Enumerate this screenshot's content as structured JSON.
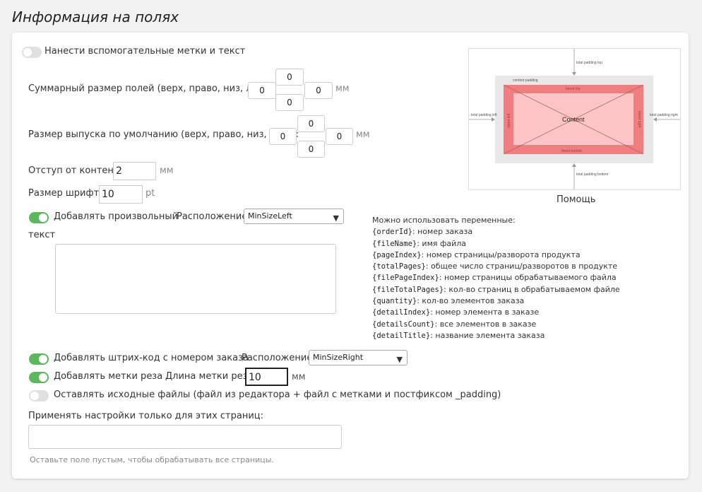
{
  "page": {
    "title": "Информация на полях"
  },
  "marks_toggle": {
    "label": "Нанести вспомогательные метки и текст",
    "on": false
  },
  "total_margins": {
    "label": "Суммарный размер полей (верх, право, низ, лево):",
    "top": "0",
    "right": "0",
    "bottom": "0",
    "left": "0",
    "unit": "мм"
  },
  "bleed": {
    "label": "Размер выпуска по умолчанию (верх, право, низ, лево):",
    "top": "0",
    "right": "0",
    "bottom": "0",
    "left": "0",
    "unit": "мм"
  },
  "content_offset": {
    "label": "Отступ от контента:",
    "value": "2",
    "unit": "мм"
  },
  "font_size": {
    "label": "Размер шрифта:",
    "value": "10",
    "unit": "pt"
  },
  "custom_text": {
    "toggle_label": "Добавлять произвольный",
    "toggle_label_2": "текст",
    "on": true,
    "position_label": "Расположение:",
    "position_value": "MinSizeLeft",
    "text": ""
  },
  "help": {
    "caption": "Помощь",
    "diagram": {
      "total_padding_top": "total padding top",
      "total_padding_left": "total padding left",
      "total_padding_right": "total padding right",
      "total_padding_bottom": "total padding bottom",
      "content_padding": "content padding",
      "bleed_top": "bleed top",
      "bleed_left": "bleed left",
      "bleed_right": "bleed right",
      "bleed_bottom": "bleed bottom",
      "content": "Content"
    }
  },
  "variables": {
    "intro": "Можно использовать переменные:",
    "items": [
      {
        "name": "{orderId}",
        "desc": ": номер заказа"
      },
      {
        "name": "{fileName}",
        "desc": ": имя файла"
      },
      {
        "name": "{pageIndex}",
        "desc": ": номер страницы/разворота продукта"
      },
      {
        "name": "{totalPages}",
        "desc": ": общее число страниц/разворотов в продукте"
      },
      {
        "name": "{filePageIndex}",
        "desc": ": номер страницы обрабатываемого файла"
      },
      {
        "name": "{fileTotalPages}",
        "desc": ": кол-во страниц в обрабатываемом файле"
      },
      {
        "name": "{quantity}",
        "desc": ": кол-во элементов заказа"
      },
      {
        "name": "{detailIndex}",
        "desc": ": номер элемента в заказе"
      },
      {
        "name": "{detailsCount}",
        "desc": ": все элементов в заказе"
      },
      {
        "name": "{detailTitle}",
        "desc": ": название элемента заказа"
      }
    ]
  },
  "barcode": {
    "label": "Добавлять штрих-код с номером заказа",
    "on": true,
    "position_label": "Расположение:",
    "position_value": "MinSizeRight"
  },
  "crop_marks": {
    "label": "Добавлять метки реза",
    "on": true,
    "length_label": "Длина метки реза:",
    "length_value": "10",
    "unit": "мм"
  },
  "keep_files": {
    "label": "Оставлять исходные файлы (файл из редактора + файл с метками и постфиксом _padding)",
    "on": false
  },
  "pages_filter": {
    "label": "Применять настройки только для этих страниц:",
    "value": "",
    "hint": "Оставьте поле пустым, чтобы обрабатывать все страницы."
  },
  "colors": {
    "toggle_on": "#5cb85c",
    "toggle_off": "#e0e0e0",
    "bleed": "#f07e80",
    "content": "#fdc5c5",
    "padding": "#e8e8e8"
  }
}
